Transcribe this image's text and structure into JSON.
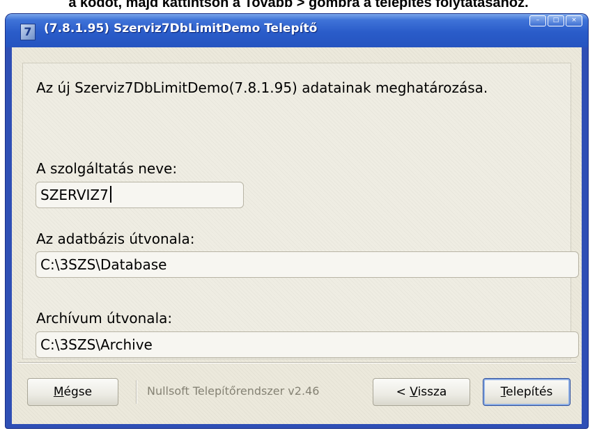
{
  "page_caption": "a kódot, majd kattintson a Tovább > gombra a telepítés folytatásához.",
  "window": {
    "title": "(7.8.1.95) Szerviz7DbLimitDemo Telepítő",
    "icon": "installer-app-icon",
    "controls": {
      "minimize_icon": "minimize-icon",
      "maximize_icon": "maximize-icon",
      "close_icon": "close-icon"
    }
  },
  "form": {
    "heading": "Az új Szerviz7DbLimitDemo(7.8.1.95) adatainak meghatározása.",
    "service_name": {
      "label": "A szolgáltatás neve:",
      "value": "SZERVIZ7"
    },
    "database_path": {
      "label": "Az adatbázis útvonala:",
      "value": "C:\\3SZS\\Database"
    },
    "archive_path": {
      "label": "Archívum útvonala:",
      "value": "C:\\3SZS\\Archive"
    }
  },
  "footer": {
    "cancel_button": {
      "accel": "M",
      "rest": "égse"
    },
    "branding": "Nullsoft Telepítőrendszer v2.46",
    "back_button": {
      "pre": "< ",
      "accel": "V",
      "rest": "issza"
    },
    "install_button": {
      "accel": "T",
      "rest": "elepítés"
    }
  },
  "colors": {
    "titlebar": "#2554c0",
    "client_bg": "#ece9dc",
    "default_button_border": "#2b4c9a"
  }
}
